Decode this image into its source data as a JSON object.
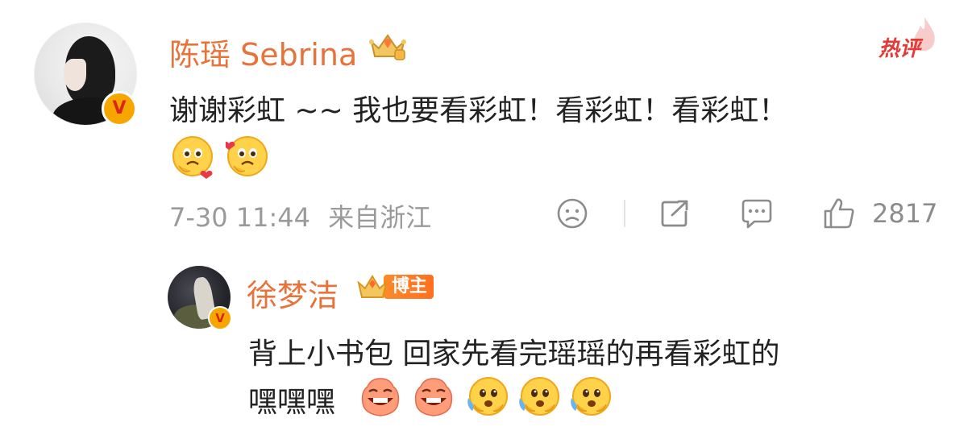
{
  "comment": {
    "username": "陈瑶 Sebrina",
    "tag": "热评",
    "text": "谢谢彩虹 ~~ 我也要看彩虹！看彩虹！看彩虹！",
    "emojis": [
      "cry-touched-emoji",
      "cry-touched-emoji"
    ],
    "timestamp": "7-30 11:44",
    "location": "来自浙江",
    "like_count": "2817",
    "colors": {
      "username": "#e8733a",
      "tag": "#e53935"
    },
    "icons": [
      "sad-face-icon",
      "share-icon",
      "comment-icon",
      "thumbs-up-icon"
    ]
  },
  "reply": {
    "username": "徐梦洁",
    "badge_label": "博主",
    "text_line1": "背上小书包 回家先看完瑶瑶的再看彩虹的",
    "text_line2": "嘿嘿嘿",
    "emojis": [
      "grin-emoji",
      "grin-emoji",
      "nervous-sweat-emoji",
      "nervous-sweat-emoji",
      "nervous-sweat-emoji"
    ],
    "colors": {
      "username": "#e8733a",
      "badge": "#ff7a22"
    }
  }
}
